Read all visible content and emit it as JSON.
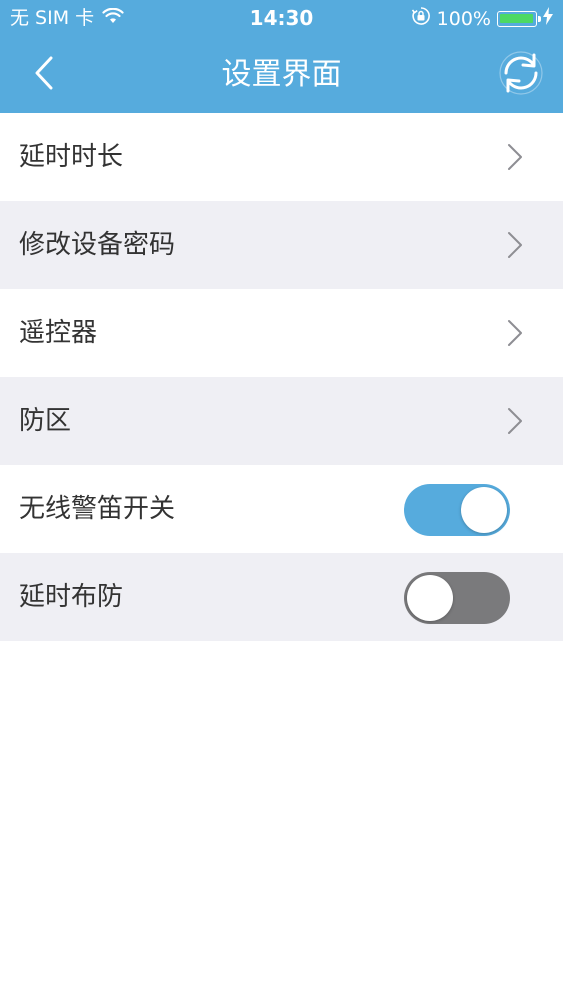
{
  "status_bar": {
    "carrier": "无 SIM 卡",
    "time": "14:30",
    "battery_percent_label": "100%",
    "battery_level": 1.0,
    "icons": [
      "wifi-icon",
      "orientation-lock-icon",
      "battery-icon",
      "charging-bolt-icon"
    ]
  },
  "nav": {
    "title": "设置界面",
    "back_icon": "chevron-left-icon",
    "refresh_icon": "refresh-icon"
  },
  "settings": {
    "items": [
      {
        "label": "延时时长",
        "control": "chevron"
      },
      {
        "label": "修改设备密码",
        "control": "chevron"
      },
      {
        "label": "遥控器",
        "control": "chevron"
      },
      {
        "label": "防区",
        "control": "chevron"
      },
      {
        "label": "无线警笛开关",
        "control": "toggle",
        "on": true
      },
      {
        "label": "延时布防",
        "control": "toggle",
        "on": false
      }
    ]
  },
  "colors": {
    "accent": "#56ABDD",
    "row_alt_bg": "#EFEFF4",
    "toggle_off": "#7A7A7C",
    "battery_green": "#4CD964"
  }
}
